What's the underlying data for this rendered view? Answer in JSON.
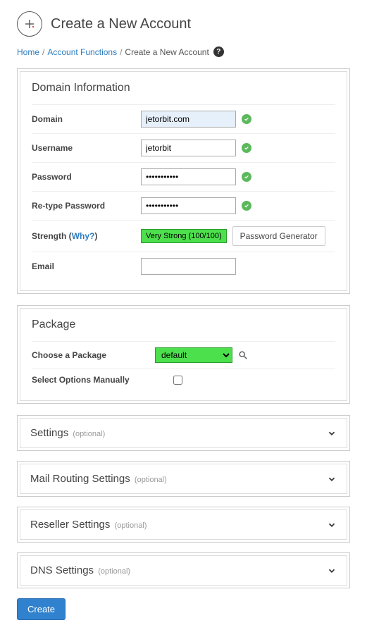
{
  "header": {
    "title": "Create a New Account"
  },
  "breadcrumb": {
    "home": "Home",
    "account_functions": "Account Functions",
    "current": "Create a New Account"
  },
  "domain_info": {
    "panel_title": "Domain Information",
    "labels": {
      "domain": "Domain",
      "username": "Username",
      "password": "Password",
      "retype_password": "Re-type Password",
      "strength": "Strength",
      "why": "Why?",
      "email": "Email"
    },
    "values": {
      "domain": "jetorbit.com",
      "username": "jetorbit",
      "password": "•••••••••••",
      "retype_password": "•••••••••••",
      "email": ""
    },
    "strength_text": "Very Strong (100/100)",
    "password_generator": "Password Generator"
  },
  "package": {
    "panel_title": "Package",
    "choose_label": "Choose a Package",
    "select_manually_label": "Select Options Manually",
    "selected": "default"
  },
  "collapsibles": {
    "settings": "Settings",
    "mail_routing": "Mail Routing Settings",
    "reseller": "Reseller Settings",
    "dns": "DNS Settings",
    "optional": "(optional)"
  },
  "buttons": {
    "create": "Create"
  }
}
